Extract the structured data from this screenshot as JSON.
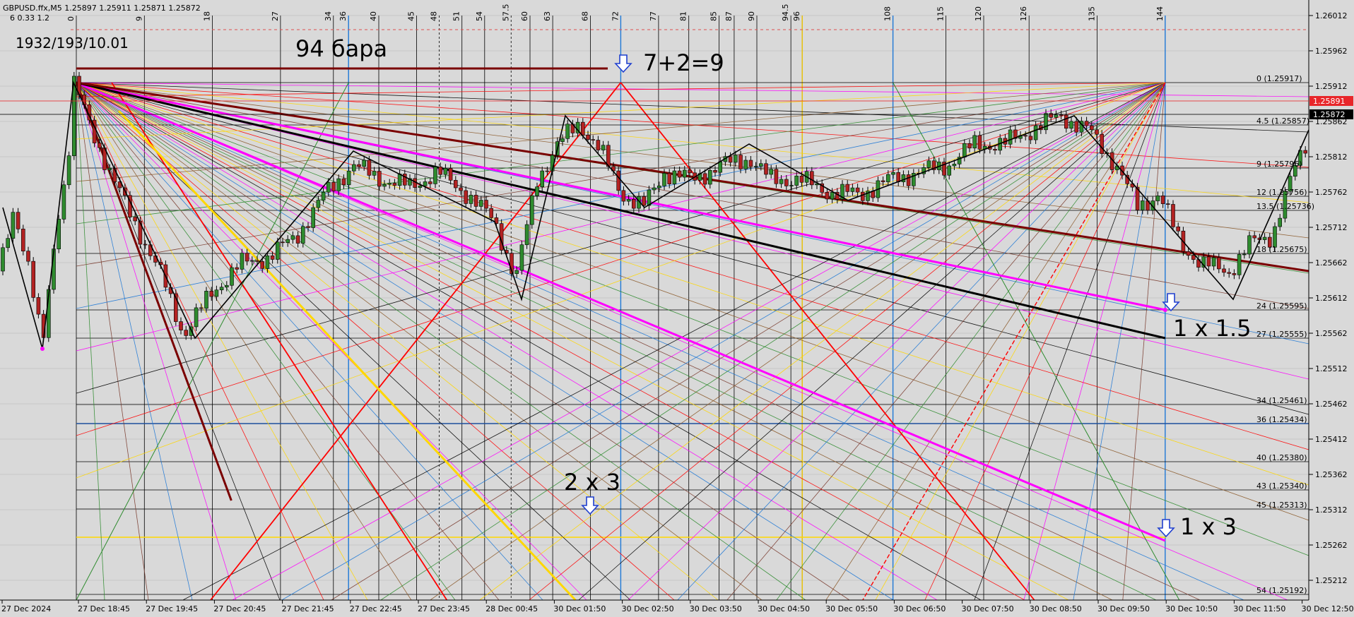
{
  "header": {
    "symbol_line": "GBPUSD.ffx,M5  1.25897 1.25911 1.25871 1.25872",
    "sub_line": "6  0.33  1.2"
  },
  "annotations": {
    "ratio_label": "1932/193/10.01",
    "bars_label": "94 бара",
    "sum_label": "7+2=9",
    "ratio_2x3": "2 x 3",
    "ratio_1x15": "1 x 1.5",
    "ratio_1x3": "1 x 3"
  },
  "chart_data": {
    "type": "candlestick",
    "symbol": "GBPUSD.ffx",
    "timeframe": "M5",
    "ohlc_last": {
      "open": 1.25897,
      "high": 1.25911,
      "low": 1.25871,
      "close": 1.25872
    },
    "price_axis": {
      "range": [
        1.25192,
        1.26012
      ],
      "ticks": [
        "1.26012",
        "1.25962",
        "1.25912",
        "1.25862",
        "1.25812",
        "1.25762",
        "1.25712",
        "1.25662",
        "1.25612",
        "1.25562",
        "1.25512",
        "1.25462",
        "1.25412",
        "1.25362",
        "1.25312",
        "1.25262",
        "1.25212"
      ],
      "current_price_tags": [
        {
          "value": 1.25891,
          "text": "1.25891",
          "color": "#e8262a"
        },
        {
          "value": 1.25872,
          "text": "1.25872",
          "color": "#000000"
        }
      ]
    },
    "time_axis": {
      "labels": [
        "27 Dec 2024",
        "27 Dec 18:45",
        "27 Dec 19:45",
        "27 Dec 20:45",
        "27 Dec 21:45",
        "27 Dec 22:45",
        "27 Dec 23:45",
        "28 Dec 00:45",
        "30 Dec 01:50",
        "30 Dec 02:50",
        "30 Dec 03:50",
        "30 Dec 04:50",
        "30 Dec 05:50",
        "30 Dec 06:50",
        "30 Dec 07:50",
        "30 Dec 08:50",
        "30 Dec 09:50",
        "30 Dec 10:50",
        "30 Dec 11:50",
        "30 Dec 12:50"
      ]
    },
    "vertical_counts": [
      "0",
      "9",
      "18",
      "27",
      "34",
      "36",
      "40",
      "45",
      "48",
      "51",
      "54",
      "57.5",
      "60",
      "63",
      "68",
      "72",
      "77",
      "81",
      "85",
      "87",
      "90",
      "94.5",
      "96",
      "108",
      "115",
      "120",
      "126",
      "135",
      "144"
    ],
    "gann_levels": [
      {
        "label": "0 (1.25917)",
        "value": 1.25917
      },
      {
        "label": "4.5 (1.25857)",
        "value": 1.25857
      },
      {
        "label": "9 (1.25796)",
        "value": 1.25796
      },
      {
        "label": "12 (1.25756)",
        "value": 1.25756
      },
      {
        "label": "13.5 (1.25736)",
        "value": 1.25736
      },
      {
        "label": "18 (1.25675)",
        "value": 1.25675
      },
      {
        "label": "24 (1.25595)",
        "value": 1.25595
      },
      {
        "label": "27 (1.25555)",
        "value": 1.25555
      },
      {
        "label": "34 (1.25461)",
        "value": 1.25461
      },
      {
        "label": "36 (1.25434)",
        "value": 1.25434
      },
      {
        "label": "40 (1.25380)",
        "value": 1.2538
      },
      {
        "label": "43 (1.25340)",
        "value": 1.2534
      },
      {
        "label": "45 (1.25313)",
        "value": 1.25313
      },
      {
        "label": "54 (1.25192)",
        "value": 1.25192
      }
    ],
    "colors": {
      "background": "#d9d9d9",
      "bull_candle": "#2e8b2e",
      "bear_candle": "#b22222",
      "fan_magenta": "#ff00ff",
      "fan_dark_red": "#7a0000",
      "fan_yellow": "#ffd700",
      "fan_red": "#ff0000",
      "fan_blue": "#1e78d6"
    }
  }
}
